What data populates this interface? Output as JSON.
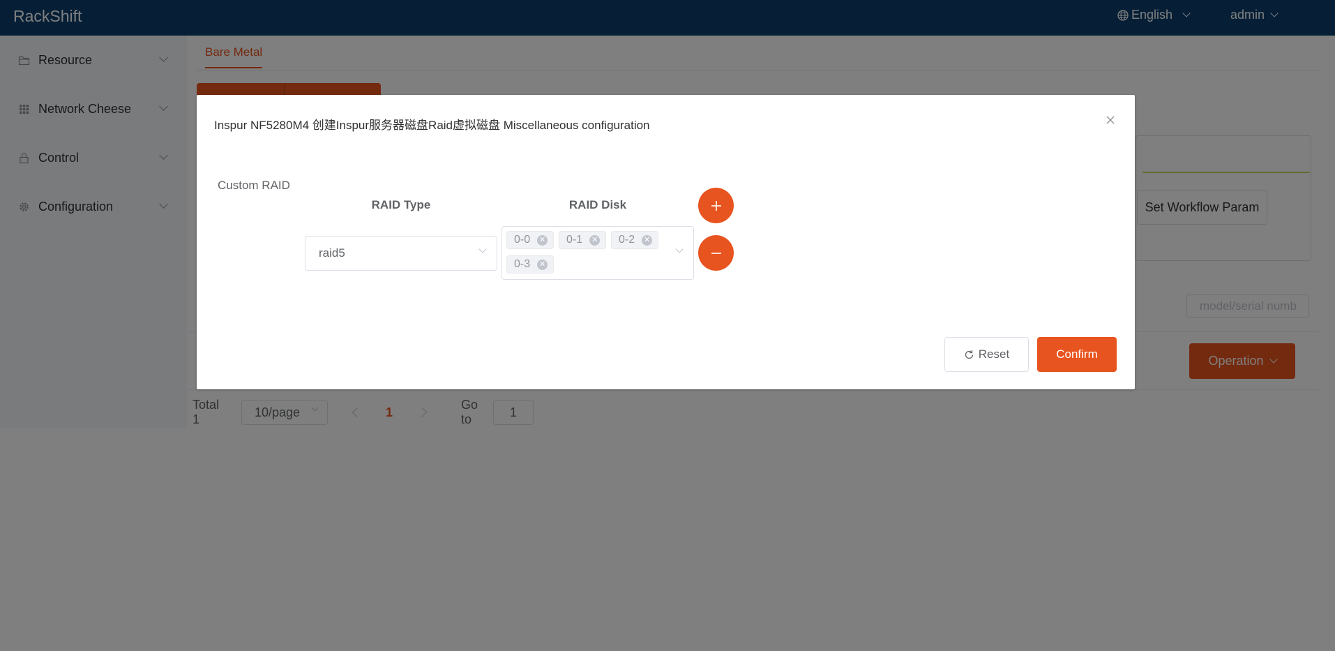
{
  "header": {
    "app_title": "RackShift",
    "language": "English",
    "user": "admin"
  },
  "sidebar": {
    "items": [
      {
        "label": "Resource",
        "icon": "folder-icon"
      },
      {
        "label": "Network Cheese",
        "icon": "grid-icon"
      },
      {
        "label": "Control",
        "icon": "lock-icon"
      },
      {
        "label": "Configuration",
        "icon": "gear-icon"
      }
    ]
  },
  "main": {
    "tab": "Bare Metal",
    "workflow_param_button": "Set Workflow Param",
    "search_placeholder": "model/serial numb",
    "operation_button": "Operation"
  },
  "pagination": {
    "total": "Total 1",
    "page_size": "10/page",
    "current_page": "1",
    "goto_label": "Go to",
    "goto_value": "1"
  },
  "dialog": {
    "title": "Inspur NF5280M4 创建Inspur服务器磁盘Raid虚拟磁盘 Miscellaneous configuration",
    "section_label": "Custom RAID",
    "raid_type_header": "RAID Type",
    "raid_disk_header": "RAID Disk",
    "raid_type_value": "raid5",
    "raid_disks": [
      "0-0",
      "0-1",
      "0-2",
      "0-3"
    ],
    "reset_label": "Reset",
    "confirm_label": "Confirm"
  },
  "colors": {
    "header_bg": "#0d3f6e",
    "accent": "#e8541f"
  }
}
